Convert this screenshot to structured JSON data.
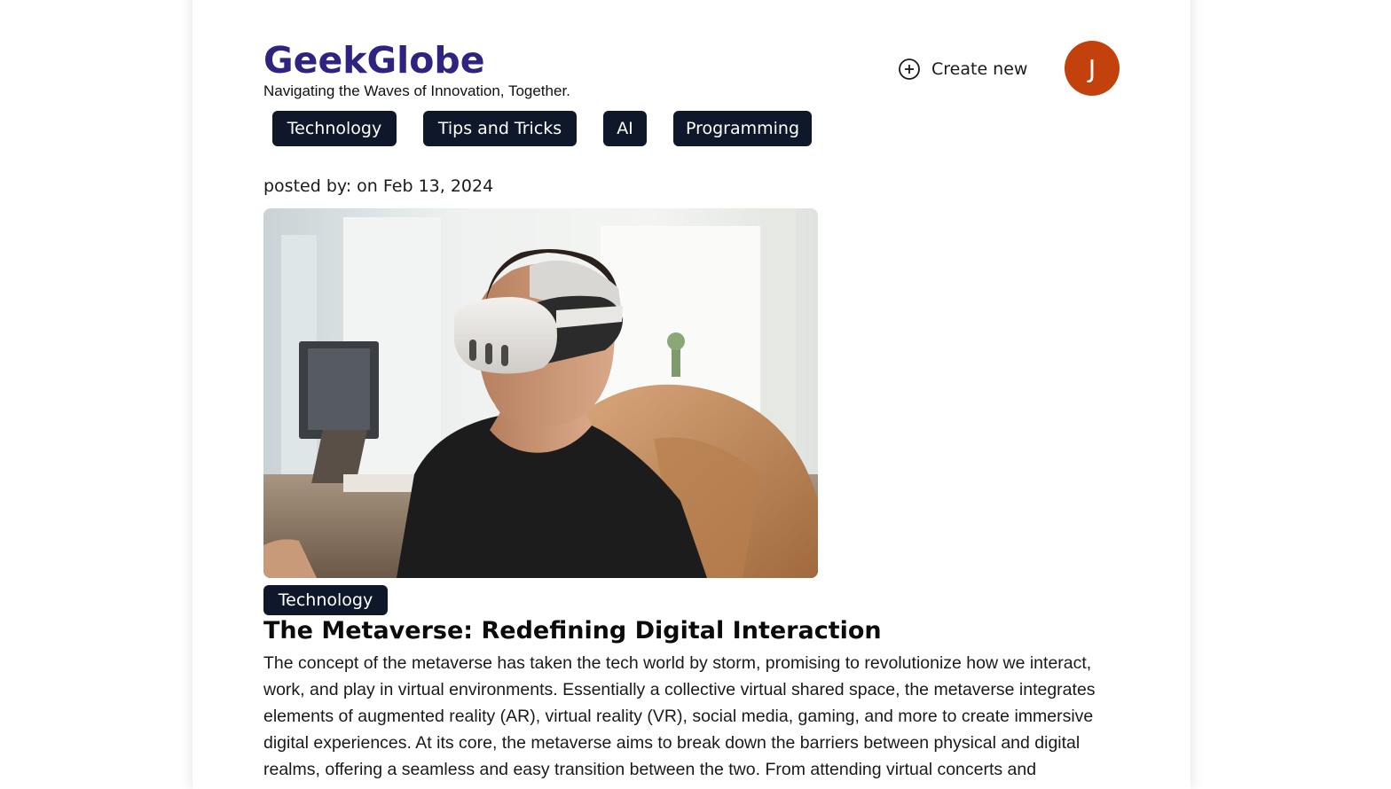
{
  "header": {
    "brand": "GeekGlobe",
    "tagline": "Navigating the Waves of Innovation, Together.",
    "create_label": "Create new",
    "avatar_initial": "J"
  },
  "nav_tags": [
    {
      "label": "Technology"
    },
    {
      "label": "Tips and Tricks"
    },
    {
      "label": "AI"
    },
    {
      "label": "Programming"
    }
  ],
  "post": {
    "meta": "posted by: on Feb 13, 2024",
    "image_icon": "vr-headset-photo",
    "category": "Technology",
    "title": "The Metaverse: Redefining Digital Interaction",
    "body": "The concept of the metaverse has taken the tech world by storm, promising to revolutionize how we interact, work, and play in virtual environments. Essentially a collective virtual shared space, the metaverse integrates elements of augmented reality (AR), virtual reality (VR), social media, gaming, and more to create immersive digital experiences. At its core, the metaverse aims to break down the barriers between physical and digital realms, offering a seamless and easy transition between the two. From attending virtual concerts and"
  },
  "colors": {
    "brand": "#2e2380",
    "tag_bg": "#0f172a",
    "avatar_bg": "#c2410c"
  }
}
